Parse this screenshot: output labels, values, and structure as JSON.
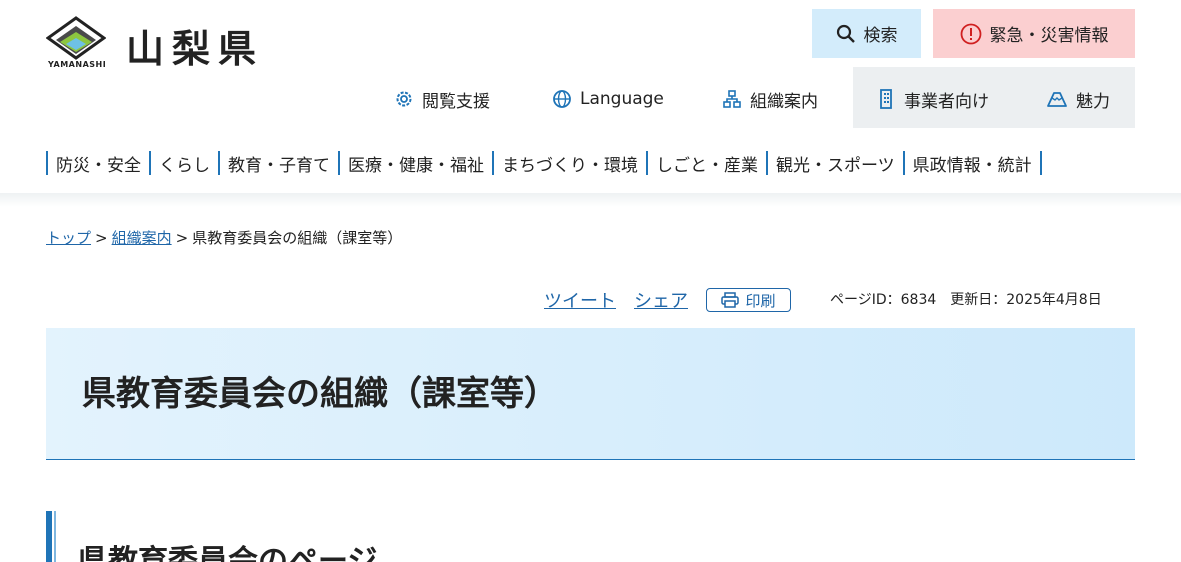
{
  "header": {
    "site_title": "山梨県",
    "logo_sub": "YAMANASHI",
    "search_label": "検索",
    "emergency_label": "緊急・災害情報",
    "util": {
      "accessibility": "閲覧支援",
      "language": "Language",
      "organization": "組織案内",
      "business": "事業者向け",
      "charm": "魅力"
    },
    "gnav": [
      "防災・安全",
      "くらし",
      "教育・子育て",
      "医療・健康・福祉",
      "まちづくり・環境",
      "しごと・産業",
      "観光・スポーツ",
      "県政情報・統計"
    ]
  },
  "breadcrumb": {
    "top": "トップ",
    "organization": "組織案内",
    "sep": ">",
    "current": "県教育委員会の組織（課室等）"
  },
  "tools": {
    "tweet": "ツイート",
    "share": "シェア",
    "print": "印刷",
    "page_meta": "ページID：6834　更新日：2025年4月8日"
  },
  "main": {
    "title": "県教育委員会の組織（課室等）",
    "section_heading": "県教育委員会のページ"
  },
  "colors": {
    "accent": "#1f74b7",
    "search_bg": "#d3ecfb",
    "emergency_bg": "#fbcfd0",
    "banner_bg": "#cde9fb"
  }
}
